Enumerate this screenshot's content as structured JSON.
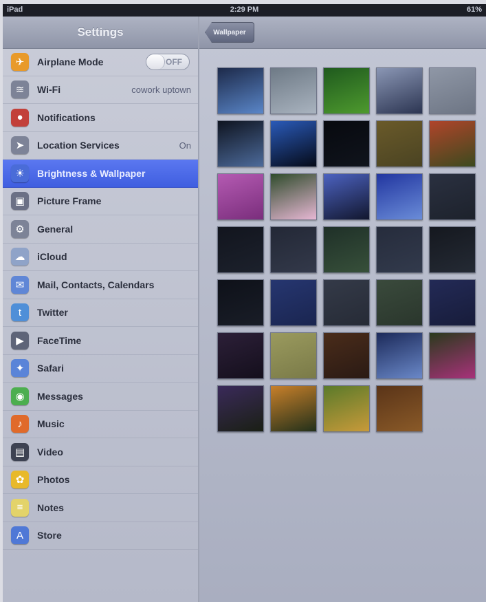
{
  "status_bar": {
    "device": "iPad",
    "time": "2:29 PM",
    "battery": "61%"
  },
  "sidebar": {
    "title": "Settings",
    "items": [
      {
        "label": "Airplane Mode",
        "icon": "airplane-icon",
        "color": "#e89a2a",
        "toggle": "OFF"
      },
      {
        "label": "Wi-Fi",
        "icon": "wifi-icon",
        "color": "#7d8397",
        "value": "cowork uptown"
      },
      {
        "label": "Notifications",
        "icon": "notifications-icon",
        "color": "#c2403a"
      },
      {
        "label": "Location Services",
        "icon": "location-icon",
        "color": "#7d8397",
        "value": "On"
      },
      {
        "label": "Brightness & Wallpaper",
        "icon": "brightness-icon",
        "color": "#4a6cd8",
        "selected": true
      },
      {
        "label": "Picture Frame",
        "icon": "picture-frame-icon",
        "color": "#6b7085"
      },
      {
        "label": "General",
        "icon": "gear-icon",
        "color": "#7d8397"
      },
      {
        "label": "iCloud",
        "icon": "cloud-icon",
        "color": "#8fa3c8"
      },
      {
        "label": "Mail, Contacts, Calendars",
        "icon": "mail-icon",
        "color": "#5f86d6"
      },
      {
        "label": "Twitter",
        "icon": "twitter-icon",
        "color": "#4f8fd8"
      },
      {
        "label": "FaceTime",
        "icon": "facetime-icon",
        "color": "#5e6478"
      },
      {
        "label": "Safari",
        "icon": "safari-icon",
        "color": "#5a84d8"
      },
      {
        "label": "Messages",
        "icon": "messages-icon",
        "color": "#4cae4f"
      },
      {
        "label": "Music",
        "icon": "music-icon",
        "color": "#e06a2a"
      },
      {
        "label": "Video",
        "icon": "video-icon",
        "color": "#3d4252"
      },
      {
        "label": "Photos",
        "icon": "photos-icon",
        "color": "#e8b92a"
      },
      {
        "label": "Notes",
        "icon": "notes-icon",
        "color": "#e3d36a"
      },
      {
        "label": "Store",
        "icon": "store-icon",
        "color": "#4f78d6"
      }
    ]
  },
  "detail": {
    "back_label": "Wallpaper",
    "wallpapers": [
      {
        "name": "wallpaper-thumb",
        "colors": [
          "#1d2a4a",
          "#5a86c8"
        ]
      },
      {
        "name": "wallpaper-thumb",
        "colors": [
          "#6e7a86",
          "#a9b3bf"
        ]
      },
      {
        "name": "wallpaper-thumb",
        "colors": [
          "#1f5a1e",
          "#4e9a2e"
        ]
      },
      {
        "name": "wallpaper-thumb",
        "colors": [
          "#8a96b4",
          "#2c3552"
        ]
      },
      {
        "name": "wallpaper-thumb",
        "colors": [
          "#8f97a6",
          "#6d7584"
        ]
      },
      {
        "name": "wallpaper-thumb",
        "colors": [
          "#0f1420",
          "#4c6a9a"
        ]
      },
      {
        "name": "wallpaper-thumb",
        "colors": [
          "#2a5ab8",
          "#050a18"
        ]
      },
      {
        "name": "wallpaper-thumb",
        "colors": [
          "#07090f",
          "#10141c"
        ]
      },
      {
        "name": "wallpaper-thumb",
        "colors": [
          "#6a5a2a",
          "#4a4322"
        ]
      },
      {
        "name": "wallpaper-thumb",
        "colors": [
          "#b0442a",
          "#3c4a1e"
        ]
      },
      {
        "name": "wallpaper-thumb",
        "colors": [
          "#b45ab2",
          "#7a2e7c"
        ]
      },
      {
        "name": "wallpaper-thumb",
        "colors": [
          "#2f4c2c",
          "#e7b7d4"
        ]
      },
      {
        "name": "wallpaper-thumb",
        "colors": [
          "#4c62c0",
          "#12172e"
        ]
      },
      {
        "name": "wallpaper-thumb",
        "colors": [
          "#2236a0",
          "#6a8cd8"
        ]
      },
      {
        "name": "wallpaper-thumb",
        "colors": [
          "#2a3040",
          "#1d222c"
        ]
      },
      {
        "name": "wallpaper-thumb",
        "colors": [
          "#12151e",
          "#1c212c"
        ]
      },
      {
        "name": "wallpaper-thumb",
        "colors": [
          "#232836",
          "#33394a"
        ]
      },
      {
        "name": "wallpaper-thumb",
        "colors": [
          "#1f3028",
          "#37503a"
        ]
      },
      {
        "name": "wallpaper-thumb",
        "colors": [
          "#262c3c",
          "#323a4c"
        ]
      },
      {
        "name": "wallpaper-thumb",
        "colors": [
          "#15181f",
          "#242a34"
        ]
      },
      {
        "name": "wallpaper-thumb",
        "colors": [
          "#0e1119",
          "#191d27"
        ]
      },
      {
        "name": "wallpaper-thumb",
        "colors": [
          "#263670",
          "#1a2550"
        ]
      },
      {
        "name": "wallpaper-thumb",
        "colors": [
          "#343a48",
          "#262b36"
        ]
      },
      {
        "name": "wallpaper-thumb",
        "colors": [
          "#3a4a3c",
          "#2a362c"
        ]
      },
      {
        "name": "wallpaper-thumb",
        "colors": [
          "#232a56",
          "#171c3a"
        ]
      },
      {
        "name": "wallpaper-thumb",
        "colors": [
          "#2c1f38",
          "#140f1c"
        ]
      },
      {
        "name": "wallpaper-thumb",
        "colors": [
          "#9a9a5e",
          "#7a7a48"
        ]
      },
      {
        "name": "wallpaper-thumb",
        "colors": [
          "#4a2c1a",
          "#2a1a14"
        ]
      },
      {
        "name": "wallpaper-thumb",
        "colors": [
          "#1c2a5a",
          "#6a88c8"
        ]
      },
      {
        "name": "wallpaper-thumb",
        "colors": [
          "#2a3a1c",
          "#a8327a"
        ]
      },
      {
        "name": "wallpaper-thumb",
        "colors": [
          "#3a2a5a",
          "#1a1f14"
        ]
      },
      {
        "name": "wallpaper-thumb",
        "colors": [
          "#c8802a",
          "#22301a"
        ]
      },
      {
        "name": "wallpaper-thumb",
        "colors": [
          "#5a7a2a",
          "#c89a3a"
        ]
      },
      {
        "name": "wallpaper-thumb",
        "colors": [
          "#5a3418",
          "#8a5a28"
        ]
      }
    ]
  }
}
